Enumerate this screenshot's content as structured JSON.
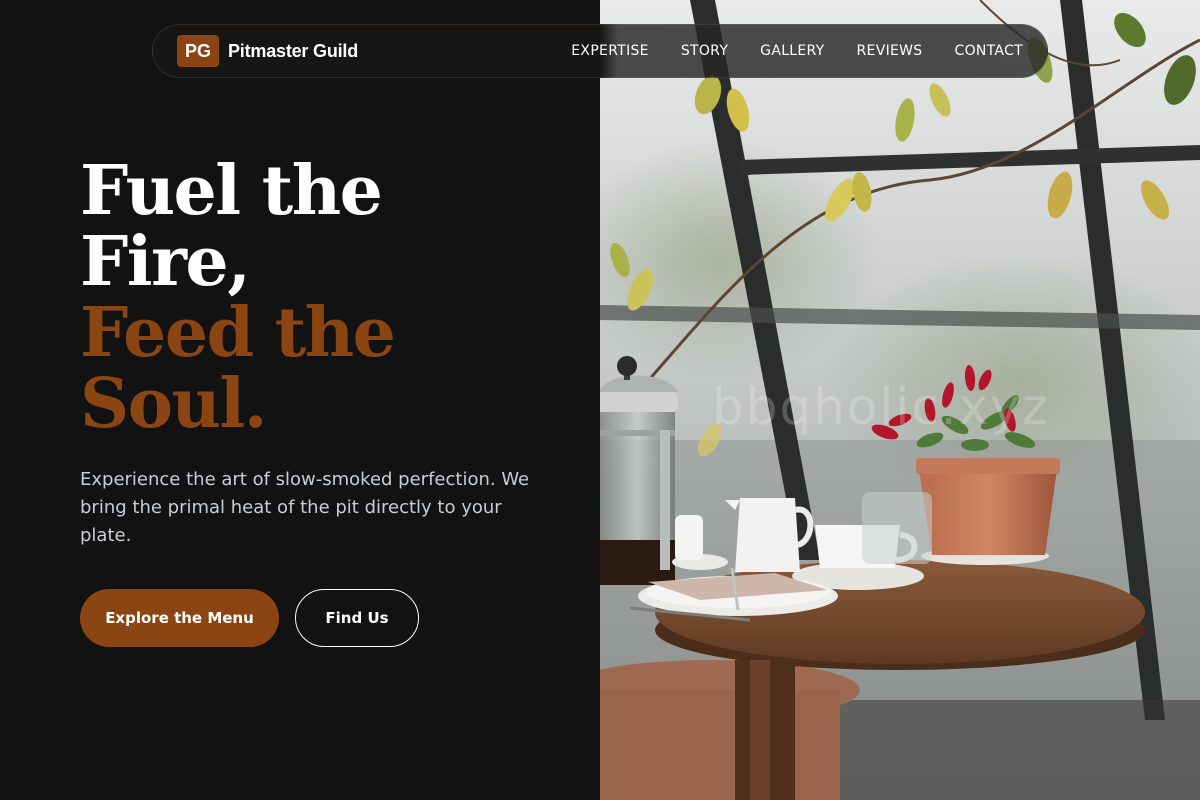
{
  "brand": {
    "logo_initials": "PG",
    "name": "Pitmaster Guild"
  },
  "nav": {
    "links": [
      "EXPERTISE",
      "STORY",
      "GALLERY",
      "REVIEWS",
      "CONTACT"
    ]
  },
  "hero": {
    "headline": {
      "line1": "Fuel the",
      "line2": "Fire,",
      "line3": "Feed the",
      "line4": "Soul."
    },
    "subtitle": "Experience the art of slow-smoked perfection. We bring the primal heat of the pit directly to your plate.",
    "primary_button": "Explore the Menu",
    "secondary_button": "Find Us"
  },
  "image": {
    "watermark": "bbqholic.xyz"
  },
  "colors": {
    "accent": "#8b4513",
    "background": "#121212",
    "text": "#ffffff",
    "muted_text": "#c9cdd4"
  },
  "icons": [
    "logo-mark"
  ]
}
